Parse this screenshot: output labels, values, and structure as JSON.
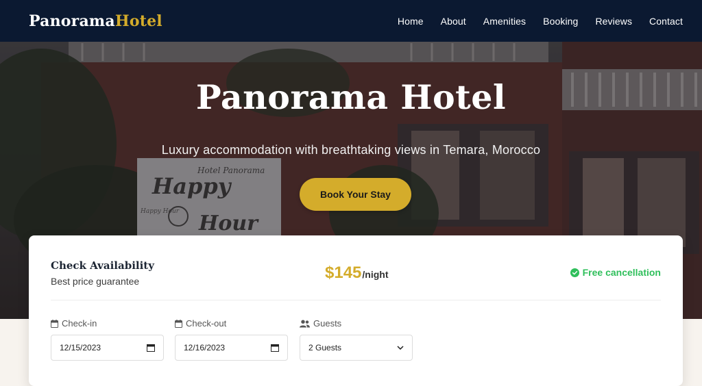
{
  "brand": {
    "name_main": "Panorama",
    "name_accent": "Hotel"
  },
  "nav": {
    "items": [
      {
        "label": "Home"
      },
      {
        "label": "About"
      },
      {
        "label": "Amenities"
      },
      {
        "label": "Booking"
      },
      {
        "label": "Reviews"
      },
      {
        "label": "Contact"
      }
    ]
  },
  "hero": {
    "title": "Panorama Hotel",
    "subtitle": "Luxury accommodation with breathtaking views in Temara, Morocco",
    "cta_label": "Book Your Stay",
    "sign_line1": "Hotel Panorama",
    "sign_line2": "Happy",
    "sign_line3": "Hour",
    "sign_small": "Happy Hour"
  },
  "availability": {
    "title": "Check Availability",
    "subtitle": "Best price guarantee",
    "price": "$145",
    "price_unit": "/night",
    "cancellation": "Free cancellation",
    "checkin": {
      "label": "Check-in",
      "value": "12/15/2023"
    },
    "checkout": {
      "label": "Check-out",
      "value": "12/16/2023"
    },
    "guests": {
      "label": "Guests",
      "value": "2 Guests"
    }
  },
  "colors": {
    "nav_bg": "#0b1931",
    "accent_gold": "#d4ac2b",
    "success_green": "#2fbf5b"
  },
  "icons": {
    "checkin": "calendar-icon",
    "checkout": "calendar-icon",
    "guests": "users-icon",
    "cancellation": "check-circle-icon"
  }
}
